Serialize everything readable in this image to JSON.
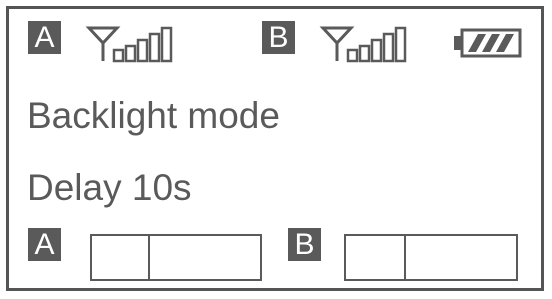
{
  "status": {
    "channel_a_label": "A",
    "channel_b_label": "B",
    "channel_a_signal_icon": "antenna-signal-icon",
    "channel_b_signal_icon": "antenna-signal-icon",
    "battery_icon": "battery-icon"
  },
  "menu": {
    "title": "Backlight mode",
    "value": "Delay 10s"
  },
  "bottom": {
    "channel_a_label": "A",
    "channel_b_label": "B"
  },
  "colors": {
    "lcd_ink": "#5a5a5a",
    "background": "#ffffff"
  }
}
